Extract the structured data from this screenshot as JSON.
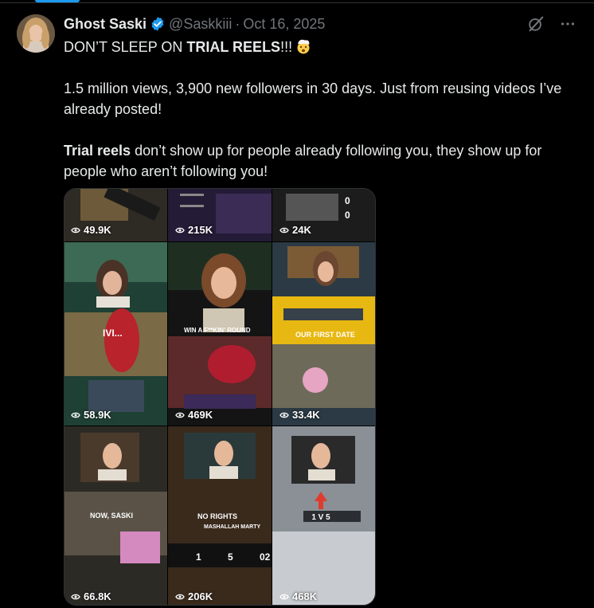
{
  "post": {
    "display_name": "Ghost Saski",
    "handle": "@Saskkiii",
    "separator": "·",
    "timestamp": "Oct 16, 2025",
    "text": {
      "line1_prefix": "DON’T SLEEP ON ",
      "line1_bold": "TRIAL REELS",
      "line1_suffix": "!!!",
      "line1_emoji": "exploding-head-emoji",
      "paragraph2": "1.5 million views, 3,900 new followers in 30 days. Just from reusing videos I’ve already posted!",
      "paragraph3_bold": "Trial reels",
      "paragraph3_rest": " don’t show up for people already following you, they show up for people who aren’t following you!"
    }
  },
  "icons": {
    "verified": "verified-badge-icon",
    "grok": "grok-icon",
    "more": "more-icon",
    "views": "eye-icon"
  },
  "colors": {
    "background": "#000000",
    "text": "#e7e9ea",
    "muted": "#71767b",
    "accent": "#1d9bf0",
    "border": "#2f3336"
  },
  "media": {
    "tiles": [
      {
        "views": "49.9K"
      },
      {
        "views": "215K"
      },
      {
        "views": "24K"
      },
      {
        "views": "58.9K",
        "caption": "IVI..."
      },
      {
        "views": "469K",
        "caption": "WIN A F**KIN' ROUND"
      },
      {
        "views": "33.4K",
        "caption": "OUR FIRST DATE"
      },
      {
        "views": "66.8K",
        "caption": "NOW, SASKI"
      },
      {
        "views": "206K",
        "caption": "NO RIGHTS",
        "sub_caption": "MASHALLAH MARTY"
      },
      {
        "views": "468K",
        "caption": "1 V 5"
      }
    ],
    "scoreboard_digits": [
      "0",
      "0"
    ],
    "bottom_numbers": [
      "1",
      "5",
      "02"
    ]
  }
}
